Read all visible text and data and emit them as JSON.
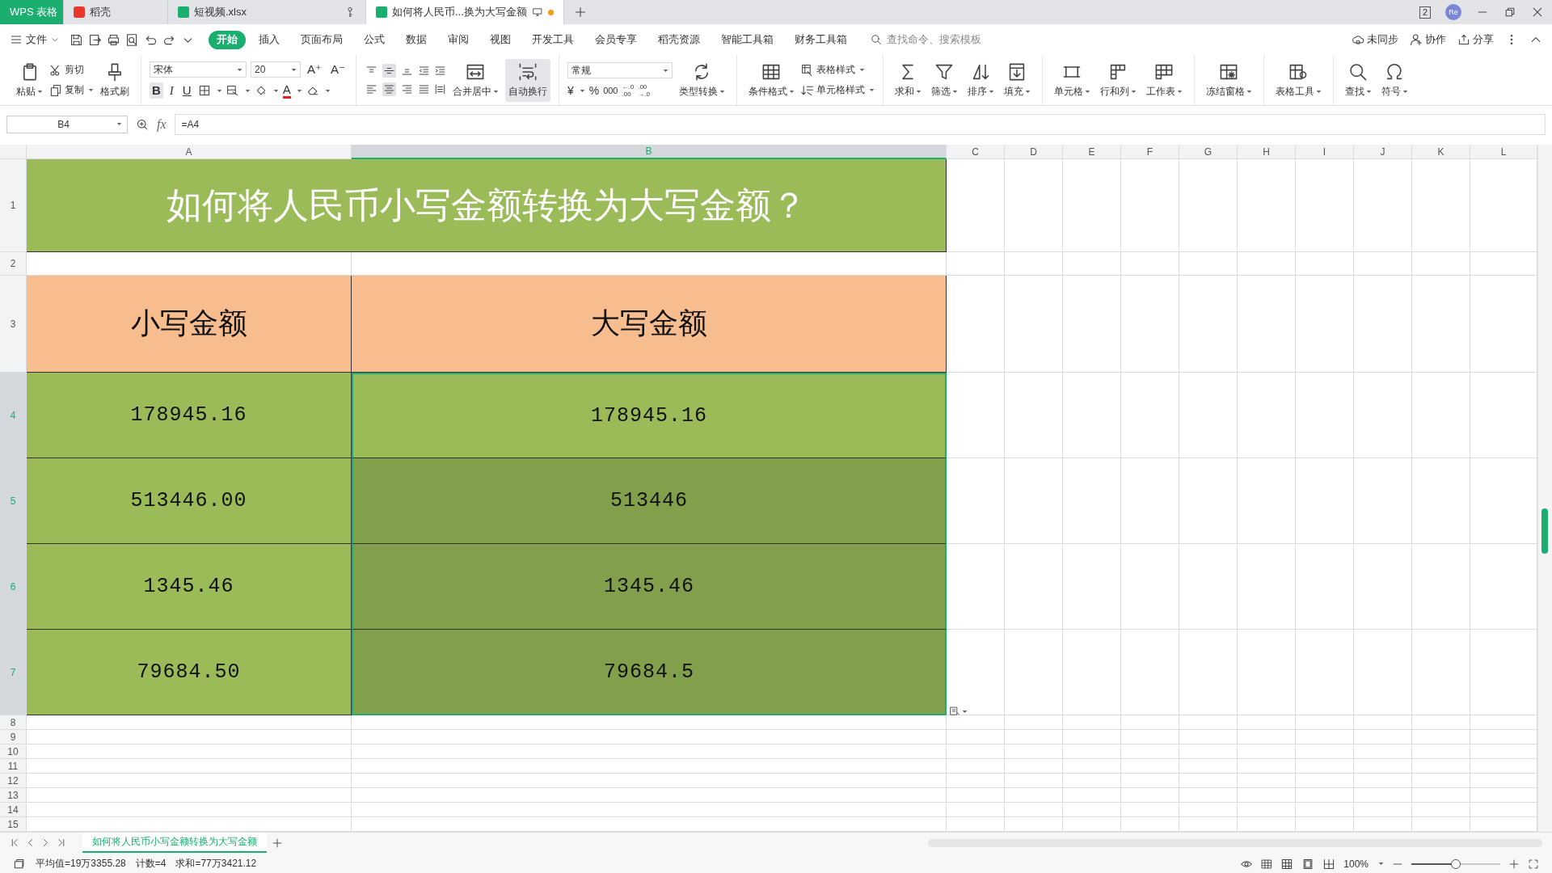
{
  "app_tabs": [
    {
      "label": "WPS 表格",
      "kind": "home",
      "selected": false
    },
    {
      "label": "稻壳",
      "kind": "docer",
      "selected": false
    },
    {
      "label": "短视频.xlsx",
      "kind": "sheet",
      "selected": false
    },
    {
      "label": "如何将人民币...换为大写金额",
      "kind": "sheet",
      "selected": true,
      "unsaved": true
    }
  ],
  "window": {
    "badge": "2",
    "avatar": "Re"
  },
  "menu": {
    "file": "文件",
    "tabs": [
      {
        "label": "开始",
        "selected": true
      },
      {
        "label": "插入",
        "selected": false
      },
      {
        "label": "页面布局",
        "selected": false
      },
      {
        "label": "公式",
        "selected": false
      },
      {
        "label": "数据",
        "selected": false
      },
      {
        "label": "审阅",
        "selected": false
      },
      {
        "label": "视图",
        "selected": false
      },
      {
        "label": "开发工具",
        "selected": false
      },
      {
        "label": "会员专享",
        "selected": false
      },
      {
        "label": "稻壳资源",
        "selected": false
      },
      {
        "label": "智能工具箱",
        "selected": false
      },
      {
        "label": "财务工具箱",
        "selected": false
      }
    ],
    "search": {
      "placeholder": "查找命令、搜索模板"
    },
    "actions": [
      "未同步",
      "协作",
      "分享"
    ]
  },
  "ribbon": {
    "clipboard": {
      "paste": "粘贴",
      "cut": "剪切",
      "copy": "复制",
      "painter": "格式刷"
    },
    "font": {
      "name": "宋体",
      "size": "20",
      "grow": "A⁺",
      "shrink": "A⁻",
      "bold": "B",
      "italic": "I",
      "underline": "U",
      "font_color_glyph": "A"
    },
    "alignment": {
      "vertical": [
        {
          "selected": false
        },
        {
          "selected": true
        },
        {
          "selected": false
        }
      ],
      "horizontal": [
        {
          "selected": false
        },
        {
          "selected": true
        },
        {
          "selected": false
        }
      ],
      "merge": "合并居中",
      "wrap": {
        "label": "自动换行",
        "selected": true
      }
    },
    "number": {
      "format": "常规",
      "currency": "¥",
      "percent": "%",
      "thousands": "000",
      "decimals": [
        {
          "top": "←.0",
          "bottom": ".00"
        },
        {
          "top": ".00",
          "bottom": "→.0"
        }
      ],
      "convert": "类型转换"
    },
    "tool_groups": [
      [
        {
          "kind": "large",
          "label": "条件格式"
        },
        {
          "kind": "stack",
          "items": [
            {
              "label": "表格样式"
            },
            {
              "label": "单元格样式"
            }
          ]
        }
      ],
      [
        {
          "kind": "large",
          "label": "求和"
        },
        {
          "kind": "large",
          "label": "筛选"
        },
        {
          "kind": "large",
          "label": "排序"
        },
        {
          "kind": "large",
          "label": "填充"
        }
      ],
      [
        {
          "kind": "large",
          "label": "单元格"
        },
        {
          "kind": "large",
          "label": "行和列"
        },
        {
          "kind": "large",
          "label": "工作表"
        }
      ],
      [
        {
          "kind": "large",
          "label": "冻结窗格"
        }
      ],
      [
        {
          "kind": "large",
          "label": "表格工具"
        }
      ],
      [
        {
          "kind": "large",
          "label": "查找"
        },
        {
          "kind": "large",
          "label": "符号"
        }
      ]
    ]
  },
  "formula_bar": {
    "name_box": "B4",
    "fx": "fx",
    "formula": "=A4"
  },
  "sheet": {
    "columns": [
      {
        "label": "A",
        "selected": false
      },
      {
        "label": "B",
        "selected": true
      },
      {
        "label": "C",
        "selected": false
      },
      {
        "label": "D",
        "selected": false
      },
      {
        "label": "E",
        "selected": false
      },
      {
        "label": "F",
        "selected": false
      },
      {
        "label": "G",
        "selected": false
      },
      {
        "label": "H",
        "selected": false
      },
      {
        "label": "I",
        "selected": false
      },
      {
        "label": "J",
        "selected": false
      },
      {
        "label": "K",
        "selected": false
      },
      {
        "label": "L",
        "selected": false
      }
    ],
    "rows": [
      {
        "number": "1",
        "kind": "title",
        "selected": false,
        "cells": [
          {
            "text": "如何将人民币小写金额转换为大写金额？"
          }
        ]
      },
      {
        "number": "2",
        "kind": "blank",
        "selected": false
      },
      {
        "number": "3",
        "kind": "header",
        "selected": false,
        "cells": [
          {
            "text": "小写金额"
          },
          {
            "text": "大写金额"
          }
        ]
      },
      {
        "number": "4",
        "kind": "data",
        "selected": true,
        "cells": [
          {
            "text": "178945.16",
            "selected": false,
            "active": false
          },
          {
            "text": "178945.16",
            "selected": true,
            "active": true
          }
        ]
      },
      {
        "number": "5",
        "kind": "data",
        "selected": true,
        "cells": [
          {
            "text": "513446.00",
            "selected": false,
            "active": false
          },
          {
            "text": "513446",
            "selected": true,
            "active": false
          }
        ]
      },
      {
        "number": "6",
        "kind": "data",
        "selected": true,
        "cells": [
          {
            "text": "1345.46",
            "selected": false,
            "active": false
          },
          {
            "text": "1345.46",
            "selected": true,
            "active": false
          }
        ]
      },
      {
        "number": "7",
        "kind": "data",
        "selected": true,
        "cells": [
          {
            "text": "79684.50",
            "selected": false,
            "active": false
          },
          {
            "text": "79684.5",
            "selected": true,
            "active": false
          }
        ]
      },
      {
        "number": "8",
        "kind": "empty",
        "selected": false
      },
      {
        "number": "9",
        "kind": "empty",
        "selected": false
      },
      {
        "number": "10",
        "kind": "empty",
        "selected": false
      },
      {
        "number": "11",
        "kind": "empty",
        "selected": false
      },
      {
        "number": "12",
        "kind": "empty",
        "selected": false
      },
      {
        "number": "13",
        "kind": "empty",
        "selected": false
      },
      {
        "number": "14",
        "kind": "empty",
        "selected": false
      },
      {
        "number": "15",
        "kind": "empty",
        "selected": false
      }
    ]
  },
  "sheet_tabs": [
    {
      "label": "如何将人民币小写金额转换为大写金额",
      "selected": true
    }
  ],
  "status": {
    "average": "平均值=19万3355.28",
    "count": "计数=4",
    "sum": "求和=77万3421.12",
    "zoom": "100%",
    "zoom_slider": {
      "level": 0.5
    }
  }
}
